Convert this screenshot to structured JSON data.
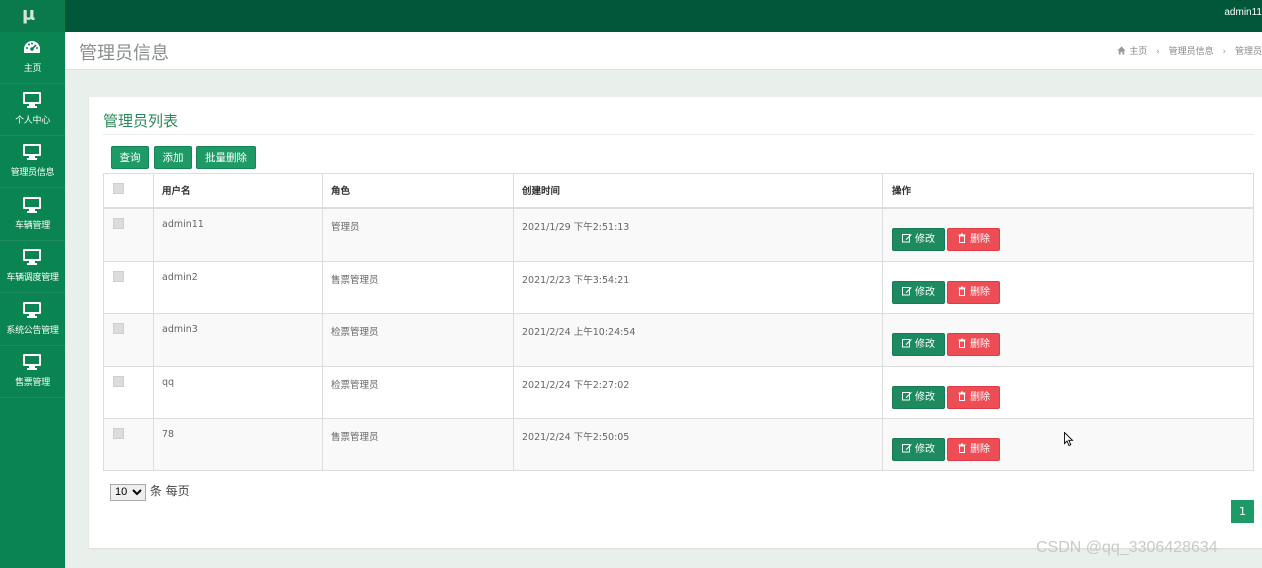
{
  "app": {
    "logo": "μ",
    "user": "admin11"
  },
  "sidebar": {
    "items": [
      {
        "label": "主页",
        "icon": "dashboard-icon"
      },
      {
        "label": "个人中心",
        "icon": "monitor-icon"
      },
      {
        "label": "管理员信息",
        "icon": "monitor-icon"
      },
      {
        "label": "车辆管理",
        "icon": "monitor-icon"
      },
      {
        "label": "车辆调度管理",
        "icon": "monitor-icon"
      },
      {
        "label": "系统公告管理",
        "icon": "monitor-icon"
      },
      {
        "label": "售票管理",
        "icon": "monitor-icon"
      }
    ]
  },
  "header": {
    "title": "管理员信息",
    "breadcrumbs": [
      "主页",
      "管理员信息",
      "管理员"
    ]
  },
  "card": {
    "title": "管理员列表",
    "buttons": {
      "query": "查询",
      "add": "添加",
      "batch_delete": "批量删除"
    }
  },
  "table": {
    "columns": [
      "用户名",
      "角色",
      "创建时间",
      "操作"
    ],
    "rows": [
      {
        "username": "admin11",
        "role": "管理员",
        "created": "2021/1/29 下午2:51:13"
      },
      {
        "username": "admin2",
        "role": "售票管理员",
        "created": "2021/2/23 下午3:54:21"
      },
      {
        "username": "admin3",
        "role": "检票管理员",
        "created": "2021/2/24 上午10:24:54"
      },
      {
        "username": "qq",
        "role": "检票管理员",
        "created": "2021/2/24 下午2:27:02"
      },
      {
        "username": "78",
        "role": "售票管理员",
        "created": "2021/2/24 下午2:50:05"
      }
    ],
    "actions": {
      "edit": "修改",
      "delete": "删除"
    }
  },
  "pager": {
    "per_page_value": "10",
    "per_page_suffix": "条 每页",
    "current_page": "1"
  },
  "watermark": "CSDN @qq_3306428634",
  "colors": {
    "topbar": "#00573a",
    "sidebar": "#0a8450",
    "accent": "#1d9a65",
    "danger": "#ef4d55"
  }
}
